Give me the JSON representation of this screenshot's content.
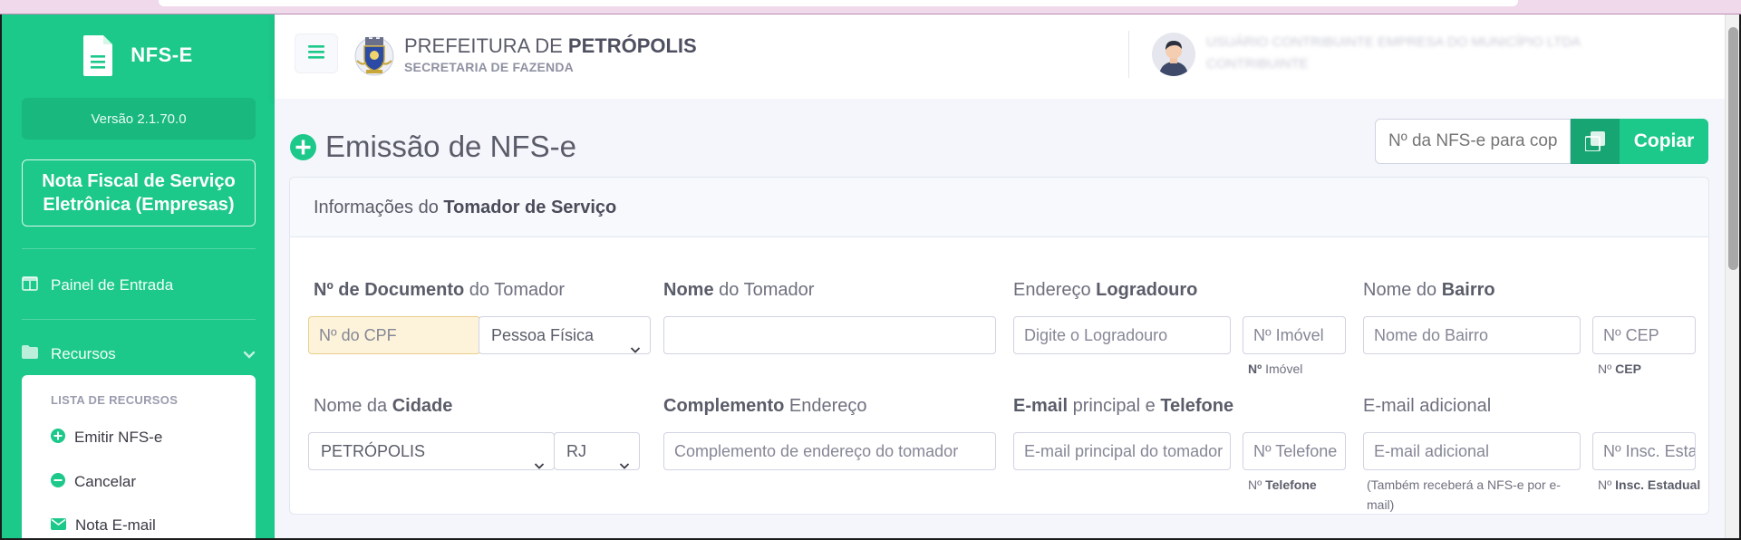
{
  "sidebar": {
    "brand": "NFS-E",
    "version": "Versão 2.1.70.0",
    "company_button": "Nota Fiscal de Serviço Eletrônica (Empresas)",
    "painel": "Painel de Entrada",
    "recursos": "Recursos",
    "submenu": {
      "heading": "LISTA DE RECURSOS",
      "items": [
        "Emitir NFS-e",
        "Cancelar",
        "Nota E-mail"
      ]
    }
  },
  "topbar": {
    "title_plain": "PREFEITURA DE ",
    "title_bold": "PETRÓPOLIS",
    "subtitle": "SECRETARIA DE FAZENDA",
    "user_name": "USUÁRIO CONTRIBUINTE EMPRESA DO MUNICÍPIO LTDA",
    "user_role": "CONTRIBUINTE"
  },
  "page": {
    "title": "Emissão de NFS-e",
    "copy_placeholder": "Nº da NFS-e para copiar",
    "copy_button": "Copiar"
  },
  "card": {
    "header_plain": "Informações do ",
    "header_bold": "Tomador de Serviço",
    "fields": {
      "documento": {
        "label_bold": "Nº de Documento",
        "label_plain": " do Tomador",
        "placeholder": "Nº do CPF",
        "select": "Pessoa Física"
      },
      "nome": {
        "label_bold": "Nome",
        "label_plain": " do Tomador",
        "value": ""
      },
      "endereco": {
        "label_plain": "Endereço ",
        "label_bold": "Logradouro",
        "placeholder": "Digite o Logradouro",
        "num_placeholder": "Nº Imóvel",
        "num_help_bold": "Nº",
        "num_help_plain": " Imóvel"
      },
      "bairro": {
        "label_plain": "Nome do ",
        "label_bold": "Bairro",
        "placeholder": "Nome do Bairro",
        "cep_placeholder": "Nº CEP",
        "cep_help_plain": "Nº ",
        "cep_help_bold": "CEP"
      },
      "cidade": {
        "label_plain": "Nome da ",
        "label_bold": "Cidade",
        "select": "PETRÓPOLIS",
        "uf": "RJ"
      },
      "complemento": {
        "label_bold": "Complemento",
        "label_plain": " Endereço",
        "placeholder": "Complemento de endereço do tomador"
      },
      "email": {
        "label_bold": "E-mail",
        "label_mid": " principal e ",
        "label_bold2": "Telefone",
        "placeholder": "E-mail principal do tomador",
        "tel_placeholder": "Nº Telefone",
        "tel_help_plain": "Nº ",
        "tel_help_bold": "Telefone"
      },
      "email_adicional": {
        "label": "E-mail adicional",
        "placeholder": "E-mail adicional",
        "help": "(Também receberá a NFS-e por e-mail)",
        "ie_placeholder": "Nº Insc. Estadual",
        "ie_help_plain": "Nº ",
        "ie_help_bold": "Insc. Estadual"
      }
    }
  },
  "colors": {
    "accent": "#1cc88a",
    "accent_dark": "#17a673",
    "bg": "#f4f6fb"
  }
}
